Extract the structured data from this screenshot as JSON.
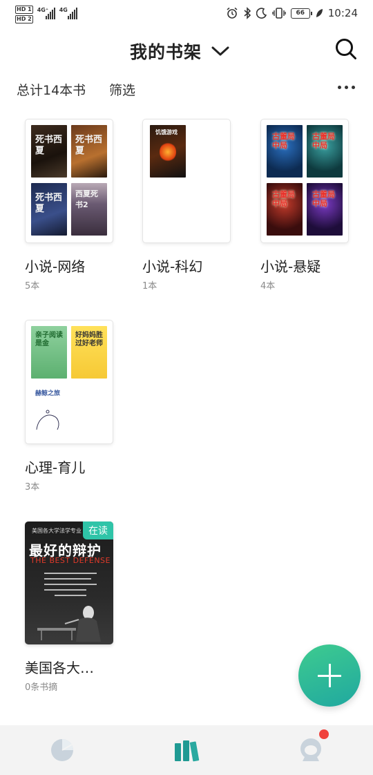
{
  "status_bar": {
    "hd1": "HD 1",
    "hd2": "HD 2",
    "net1": "4G⁺",
    "net2": "4G",
    "battery": "66",
    "time": "10:24"
  },
  "header": {
    "title": "我的书架",
    "dropdown_icon": "chevron-down-icon",
    "search_icon": "search-icon"
  },
  "toolbar": {
    "total": "总计14本书",
    "filter": "筛选",
    "more_icon": "more-dots-icon"
  },
  "shelf": [
    {
      "name": "小说-网络",
      "count": "5本",
      "covers": [
        "死书西夏",
        "死书西夏",
        "死书西夏",
        "西夏死书2"
      ]
    },
    {
      "name": "小说-科幻",
      "count": "1本",
      "covers": [
        "饥饿游戏"
      ]
    },
    {
      "name": "小说-悬疑",
      "count": "4本",
      "covers": [
        "古董局中局",
        "古董局中局",
        "古董局中局",
        "古董局中局"
      ]
    },
    {
      "name": "心理-育儿",
      "count": "3本",
      "covers": [
        "亲子阅读是金",
        "好妈妈胜过好老师",
        "赫鲸之旅"
      ]
    }
  ],
  "reading_book": {
    "name": "美国各大…",
    "count": "0条书摘",
    "badge": "在读",
    "cover_top": "美国各大学法学专业",
    "cover_title": "最好的辩护",
    "cover_subtitle": "THE BEST DEFENSE"
  },
  "fab": {
    "icon": "plus-icon"
  },
  "bottom_nav": {
    "items": [
      {
        "icon": "pie-chart-icon"
      },
      {
        "icon": "bookshelf-icon"
      },
      {
        "icon": "astronaut-icon"
      }
    ]
  },
  "colors": {
    "accent": "#2fc4a8",
    "nav_active": "#1f9a93",
    "nav_inactive": "#c9d3dc",
    "badge_dot": "#f0423c"
  }
}
